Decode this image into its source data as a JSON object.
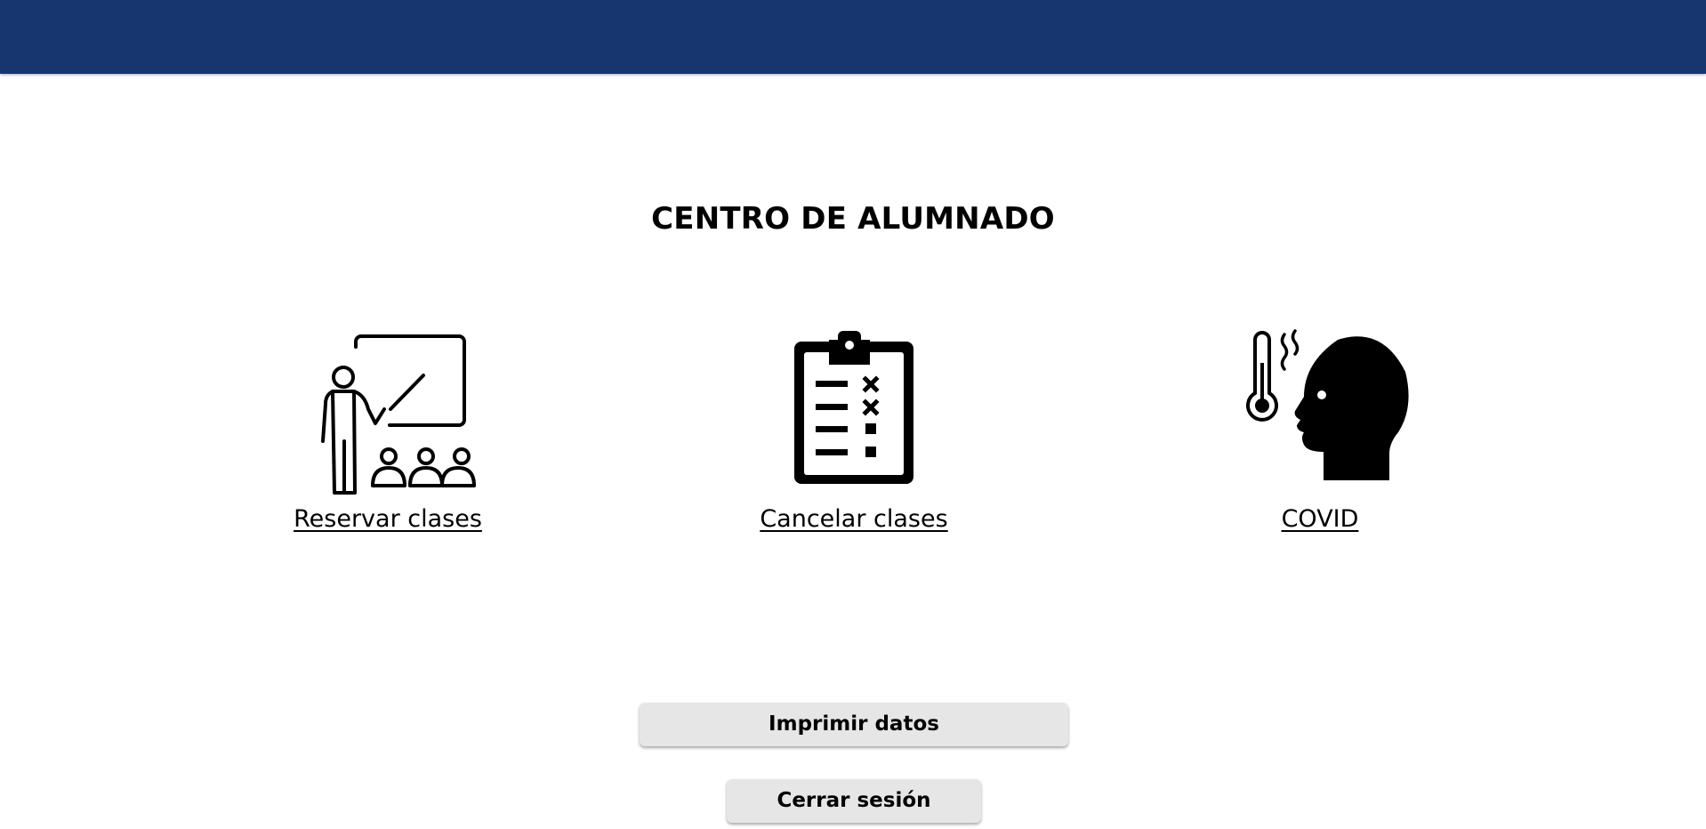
{
  "header": {
    "bar_color": "#173670"
  },
  "main": {
    "title": "CENTRO DE ALUMNADO",
    "options": [
      {
        "label": "Reservar clases",
        "icon": "teacher-classroom-icon"
      },
      {
        "label": "Cancelar clases",
        "icon": "clipboard-checklist-icon"
      },
      {
        "label": "COVID",
        "icon": "fever-head-icon"
      }
    ]
  },
  "actions": {
    "print_label": "Imprimir datos",
    "logout_label": "Cerrar sesión"
  }
}
